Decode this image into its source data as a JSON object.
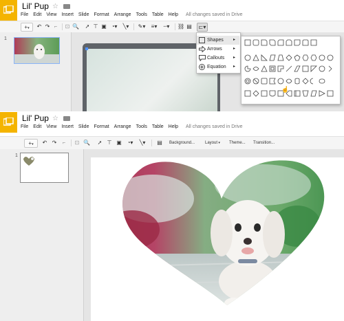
{
  "doc": {
    "title": "Lil' Pup",
    "star": "☆",
    "saved_status": "All changes saved in Drive"
  },
  "menu": [
    "File",
    "Edit",
    "View",
    "Insert",
    "Slide",
    "Format",
    "Arrange",
    "Tools",
    "Table",
    "Help"
  ],
  "toolbar": {
    "add": "+",
    "background": "Background...",
    "layout": "Layout",
    "theme": "Theme...",
    "transition": "Transition..."
  },
  "slide_number": "1",
  "shape_menu": {
    "items": [
      {
        "label": "Shapes",
        "icon": "square-icon"
      },
      {
        "label": "Arrows",
        "icon": "arrow-icon"
      },
      {
        "label": "Callouts",
        "icon": "callout-icon"
      },
      {
        "label": "Equation",
        "icon": "plus-circle-icon"
      }
    ],
    "arrow": "▸"
  },
  "colors": {
    "logo": "#f4b400",
    "menu_highlight": "#e8e8e8",
    "selection": "#4d90fe"
  }
}
